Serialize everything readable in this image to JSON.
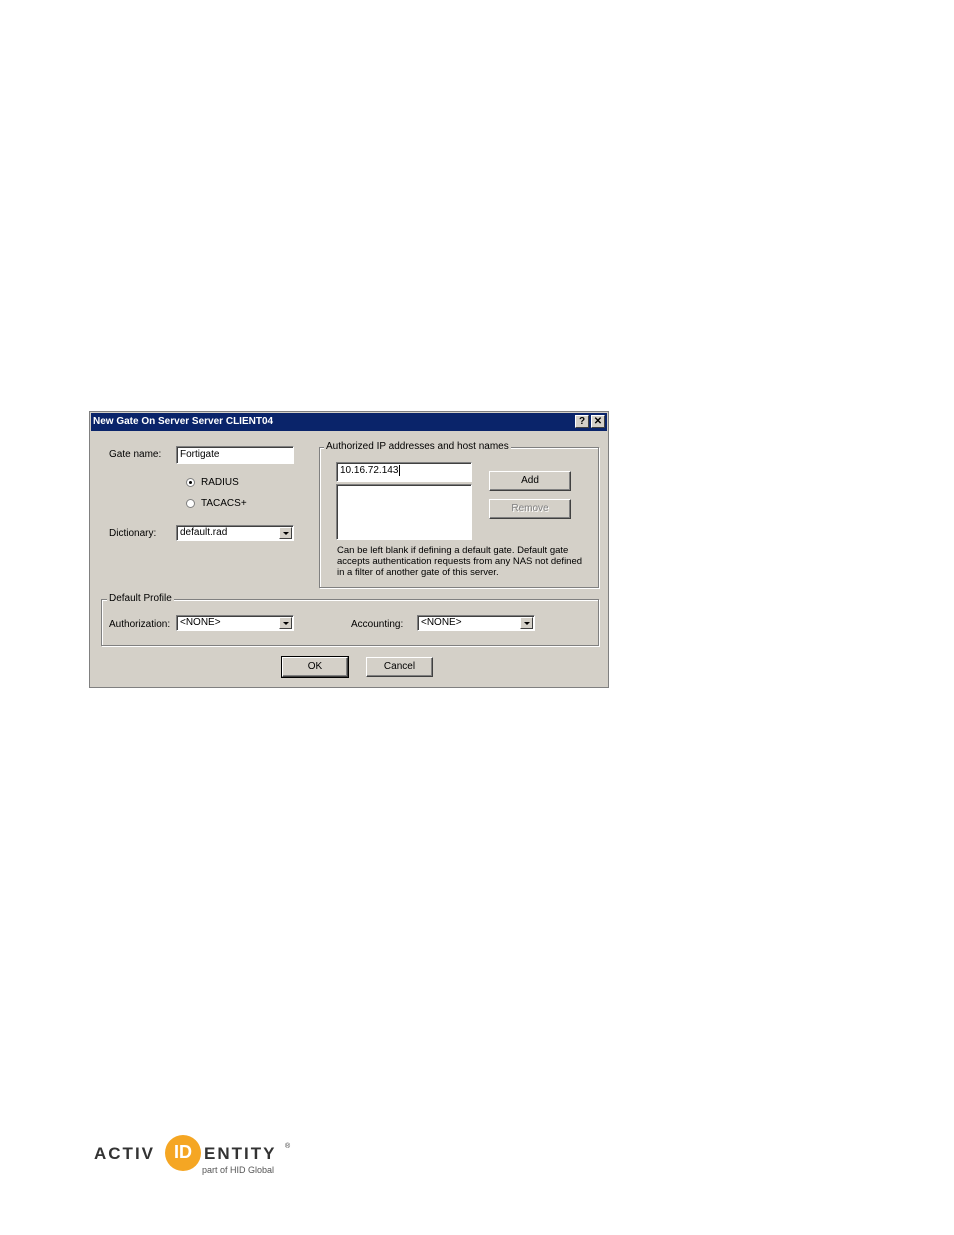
{
  "dialog": {
    "title": "New Gate On Server Server CLIENT04",
    "help_glyph": "?",
    "close_glyph": "✕",
    "gate_name_label": "Gate name:",
    "gate_name_value": "Fortigate",
    "protocol_options": [
      {
        "label": "RADIUS",
        "checked": true
      },
      {
        "label": "TACACS+",
        "checked": false
      }
    ],
    "dictionary_label": "Dictionary:",
    "dictionary_value": "default.rad",
    "authorized_group_title": "Authorized IP addresses and host names",
    "ip_input_value": "10.16.72.143",
    "add_label": "Add",
    "remove_label": "Remove",
    "note": "Can be left blank if defining a default gate. Default gate accepts authentication requests from any NAS not defined in a filter of another gate of this server.",
    "default_profile_title": "Default Profile",
    "authorization_label": "Authorization:",
    "authorization_value": "<NONE>",
    "accounting_label": "Accounting:",
    "accounting_value": "<NONE>",
    "ok_label": "OK",
    "cancel_label": "Cancel"
  },
  "footer_logo": {
    "left_text": "ACTIV",
    "badge_text": "ID",
    "right_text": "ENTITY",
    "trademark": "®",
    "subtitle": "part of HID Global",
    "brand_color": "#f5a623"
  }
}
